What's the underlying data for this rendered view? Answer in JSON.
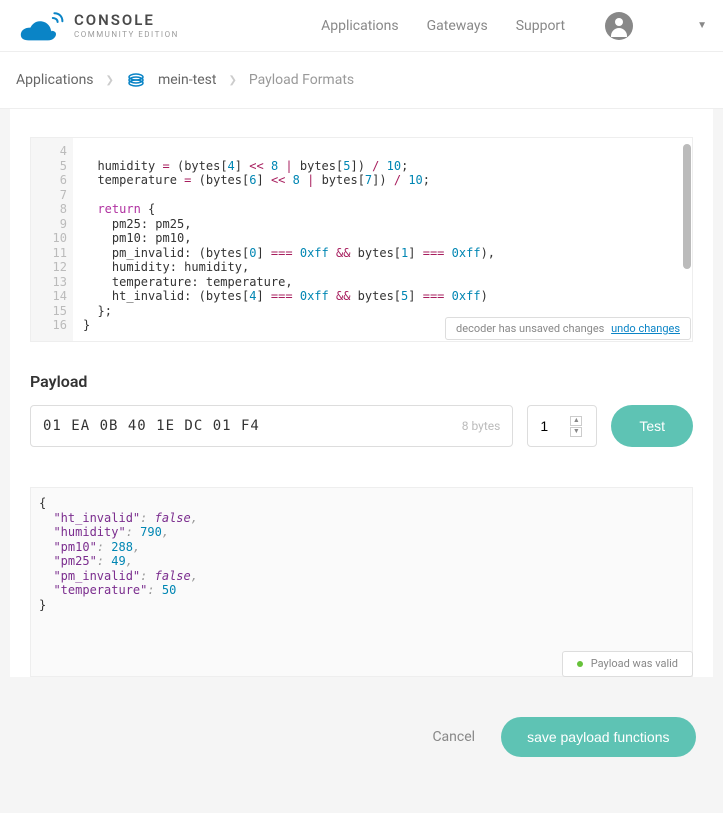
{
  "header": {
    "logo_title": "CONSOLE",
    "logo_subtitle": "COMMUNITY EDITION",
    "nav": [
      "Applications",
      "Gateways",
      "Support"
    ]
  },
  "breadcrumb": {
    "items": [
      "Applications",
      "mein-test",
      "Payload Formats"
    ]
  },
  "editor": {
    "first_line_number": 4,
    "lines": [
      "",
      "  humidity = (bytes[4] << 8 | bytes[5]) / 10;",
      "  temperature = (bytes[6] << 8 | bytes[7]) / 10;",
      "",
      "  return {",
      "    pm25: pm25,",
      "    pm10: pm10,",
      "    pm_invalid: (bytes[0] === 0xff && bytes[1] === 0xff),",
      "    humidity: humidity,",
      "    temperature: temperature,",
      "    ht_invalid: (bytes[4] === 0xff && bytes[5] === 0xff)",
      "  };",
      "}"
    ],
    "unsaved_text": "decoder has unsaved changes",
    "undo_text": "undo changes"
  },
  "payload": {
    "title": "Payload",
    "hex": "01 EA 0B 40 1E DC 01 F4",
    "bytes_label": "8 bytes",
    "port": "1",
    "test_label": "Test"
  },
  "result": {
    "data": {
      "ht_invalid": false,
      "humidity": 790,
      "pm10": 288,
      "pm25": 49,
      "pm_invalid": false,
      "temperature": 50
    },
    "valid_text": "Payload was valid"
  },
  "footer": {
    "cancel": "Cancel",
    "save": "save payload functions"
  },
  "chart_data": null
}
